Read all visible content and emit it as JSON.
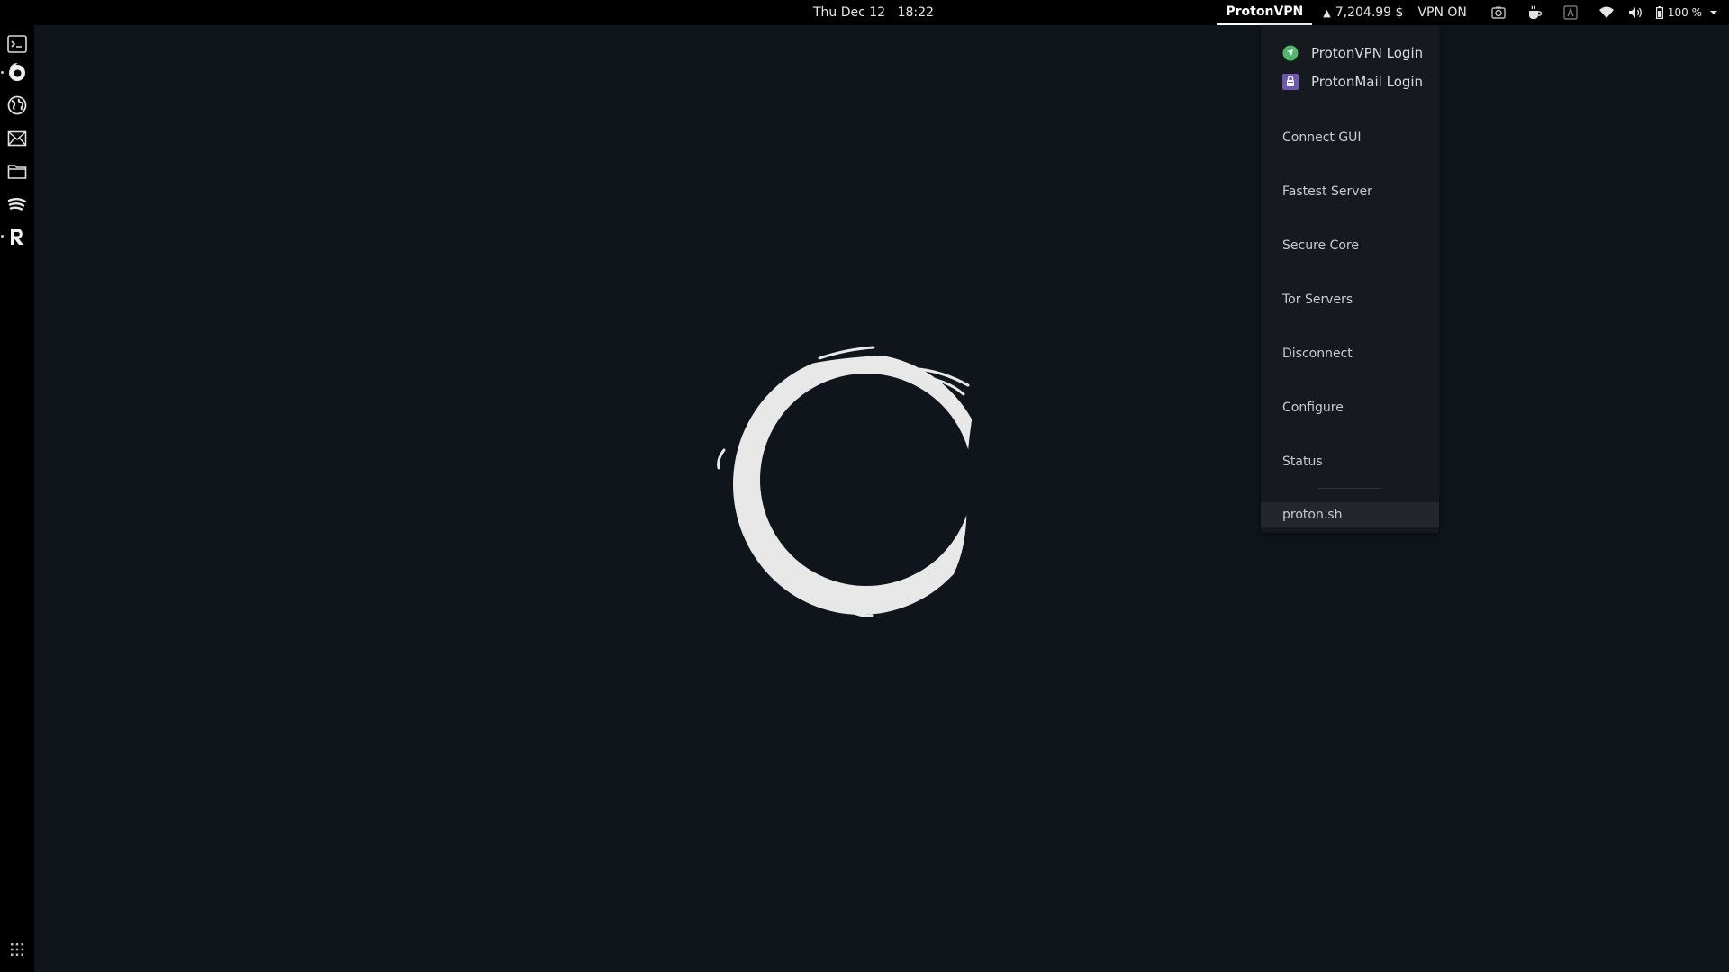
{
  "topbar": {
    "clock": {
      "day": "Thu Dec 12",
      "time": "18:22"
    },
    "protonvpn_indicator": "ProtonVPN",
    "crypto": {
      "arrow": "▲",
      "value": "7,204.99 $"
    },
    "vpn_status": "VPN ON",
    "tray_icons": [
      "screenshot-icon",
      "coffee-icon",
      "keyboard-icon",
      "wifi-icon",
      "volume-icon"
    ],
    "battery": "100 %"
  },
  "dock": {
    "items": [
      "terminal-icon",
      "firefox-icon",
      "web-browser-icon",
      "mail-icon",
      "files-icon",
      "spotify-icon",
      "r-studio-icon"
    ],
    "apps_grid": "app-grid-icon"
  },
  "menu": {
    "logins": [
      {
        "label": "ProtonVPN Login",
        "icon": "protonvpn-icon",
        "color": "#4fb86a"
      },
      {
        "label": "ProtonMail Login",
        "icon": "protonmail-icon",
        "color": "#6d5ab0"
      }
    ],
    "items": [
      "Connect GUI",
      "Fastest Server",
      "Secure Core",
      "Tor Servers",
      "Disconnect",
      "Configure",
      "Status"
    ],
    "footer": "proton.sh"
  },
  "colors": {
    "desktop_bg": "#0f151b",
    "bar_bg": "#000000",
    "menu_bg": "#161a1e",
    "logo": "#e8e8e8"
  }
}
